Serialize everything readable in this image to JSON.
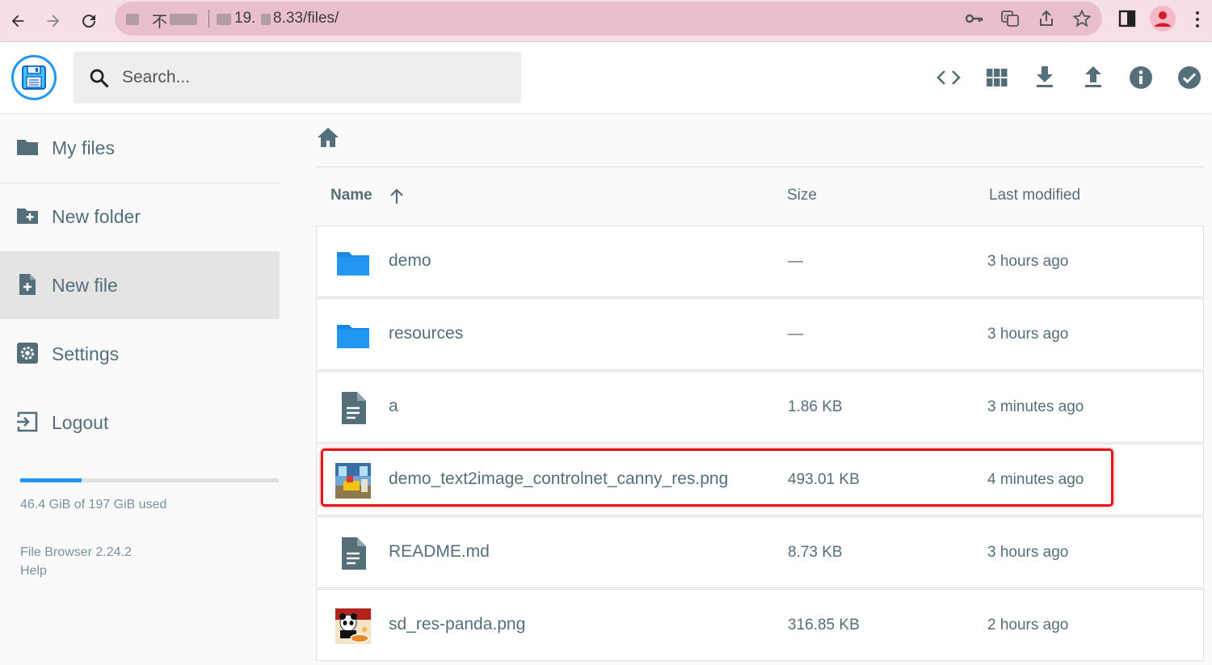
{
  "browser": {
    "url_mid": "19.",
    "url_end": "8.33/files/",
    "url_prefix_char": "不"
  },
  "header": {
    "search_placeholder": "Search...",
    "icons": [
      "code-icon",
      "grid-view-icon",
      "download-icon",
      "upload-icon",
      "info-icon",
      "check-circle-icon"
    ]
  },
  "sidebar": {
    "items": [
      {
        "label": "My files",
        "icon": "folder-icon"
      },
      {
        "label": "New folder",
        "icon": "folder-plus-icon"
      },
      {
        "label": "New file",
        "icon": "file-plus-icon"
      },
      {
        "label": "Settings",
        "icon": "settings-icon"
      },
      {
        "label": "Logout",
        "icon": "logout-icon"
      }
    ],
    "storage_used_fraction": 0.236,
    "storage_text": "46.4 GiB of 197 GiB used",
    "version_text": "File Browser 2.24.2",
    "help_text": "Help"
  },
  "list": {
    "columns": {
      "name": "Name",
      "size": "Size",
      "modified": "Last modified"
    },
    "rows": [
      {
        "name": "demo",
        "size": "—",
        "modified": "3 hours ago",
        "type": "folder"
      },
      {
        "name": "resources",
        "size": "—",
        "modified": "3 hours ago",
        "type": "folder"
      },
      {
        "name": "a",
        "size": "1.86 KB",
        "modified": "3 minutes ago",
        "type": "file"
      },
      {
        "name": "demo_text2image_controlnet_canny_res.png",
        "size": "493.01 KB",
        "modified": "4 minutes ago",
        "type": "image",
        "highlighted": true
      },
      {
        "name": "README.md",
        "size": "8.73 KB",
        "modified": "3 hours ago",
        "type": "file"
      },
      {
        "name": "sd_res-panda.png",
        "size": "316.85 KB",
        "modified": "2 hours ago",
        "type": "image"
      }
    ]
  },
  "colors": {
    "accent": "#2196f3",
    "highlight": "#e3141c",
    "text": "#546e7a",
    "chrome": "#f6dfe6"
  }
}
